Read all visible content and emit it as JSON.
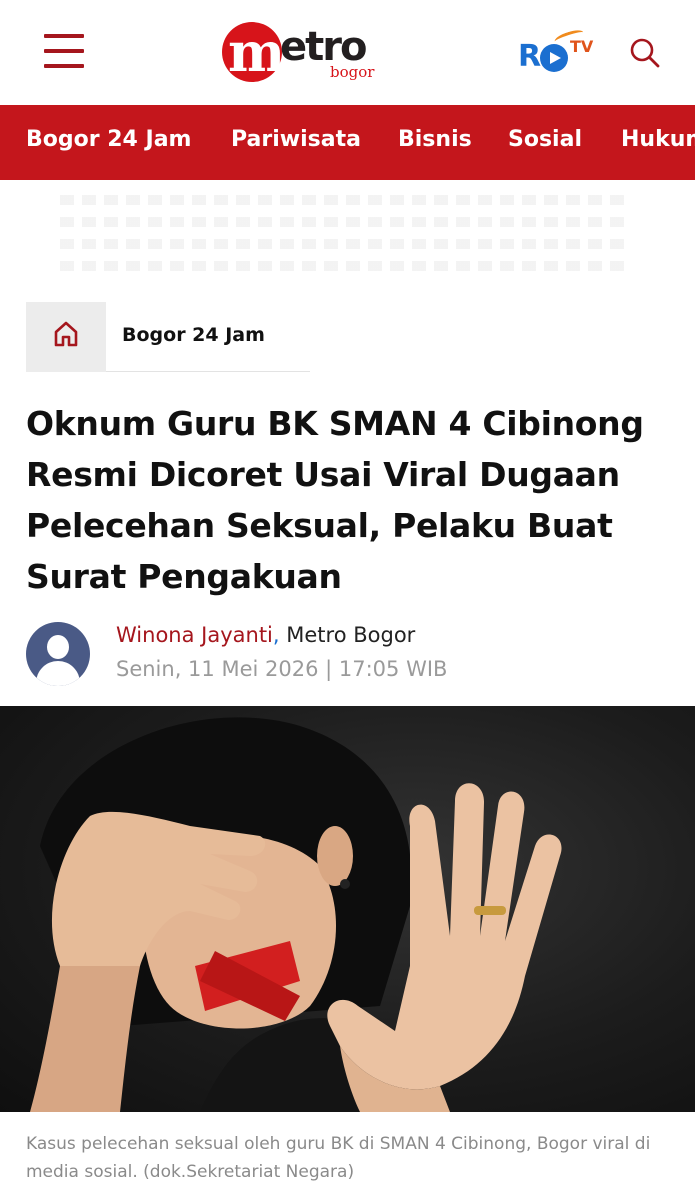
{
  "header": {
    "logo_main": "metro",
    "logo_sub": "bogor",
    "partner_logo_r": "R",
    "partner_logo_tv": "TV",
    "icons": {
      "menu": "hamburger-menu-icon",
      "search": "search-icon",
      "home": "home-icon"
    }
  },
  "nav": {
    "items": [
      {
        "label": "Bogor 24 Jam"
      },
      {
        "label": "Pariwisata"
      },
      {
        "label": "Bisnis"
      },
      {
        "label": "Sosial"
      },
      {
        "label": "Hukum"
      }
    ]
  },
  "breadcrumb": {
    "label": "Bogor 24 Jam"
  },
  "article": {
    "title": "Oknum Guru BK SMAN 4 Cibinong Resmi Dicoret Usai Viral Dugaan Pelecehan Seksual, Pelaku Buat Surat Pengakuan",
    "author": "Winona Jayanti",
    "separator": ",",
    "publisher": "Metro Bogor",
    "date": "Senin, 11 Mei 2026 | 17:05 WIB",
    "caption": "Kasus pelecehan seksual oleh guru BK di SMAN 4 Cibinong, Bogor viral di media sosial. (dok.Sekretariat Negara)"
  },
  "colors": {
    "brand_red": "#c4161c",
    "author_red": "#a5161d",
    "partner_blue": "#1b6fd0",
    "muted_text": "#9a9a9a"
  }
}
